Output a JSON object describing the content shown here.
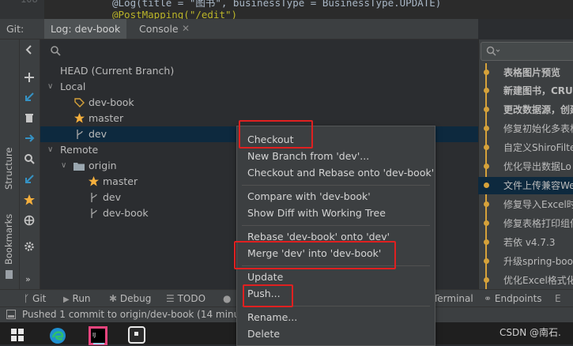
{
  "editor": {
    "line_number": "108",
    "line1": "@Log(title = \"图书\", businessType = BusinessType.UPDATE)",
    "line2": "@PostMapping(\"/edit\")"
  },
  "tabs": {
    "git": "Git:",
    "log": "Log: dev-book",
    "console": "Console"
  },
  "tree": {
    "head": "HEAD (Current Branch)",
    "local": "Local",
    "local_branches": [
      "dev-book",
      "master",
      "dev"
    ],
    "remote": "Remote",
    "origin": "origin",
    "remote_branches": [
      "master",
      "dev",
      "dev-book"
    ]
  },
  "commits": [
    "表格图片预览",
    "新建图书，CRUD",
    "更改数据源，创建",
    "修复初始化多表格",
    "自定义ShiroFilte",
    "优化导出数据Lo",
    "文件上传兼容We",
    "修复导入Excel时",
    "修复表格打印组件",
    "若依 v4.7.3",
    "升级spring-boo",
    "优化Excel格式化"
  ],
  "menu": {
    "checkout": "Checkout",
    "new_branch": "New Branch from 'dev'...",
    "checkout_rebase": "Checkout and Rebase onto 'dev-book'",
    "compare": "Compare with 'dev-book'",
    "show_diff": "Show Diff with Working Tree",
    "rebase": "Rebase 'dev-book' onto 'dev'",
    "merge": "Merge 'dev' into 'dev-book'",
    "update": "Update",
    "push": "Push...",
    "rename": "Rename...",
    "delete": "Delete"
  },
  "side_labels": {
    "structure": "Structure",
    "bookmarks": "Bookmarks"
  },
  "toolbar": {
    "git": "Git",
    "run": "Run",
    "debug": "Debug",
    "todo": "TODO",
    "terminal": "Terminal",
    "endpoints": "Endpoints"
  },
  "status": {
    "message": "Pushed 1 commit to origin/dev-book (14 minut"
  },
  "watermark": "CSDN @南石.",
  "colors": {
    "highlight": "#e02020",
    "selection": "#0d293e",
    "graph": "#d6a23a"
  }
}
